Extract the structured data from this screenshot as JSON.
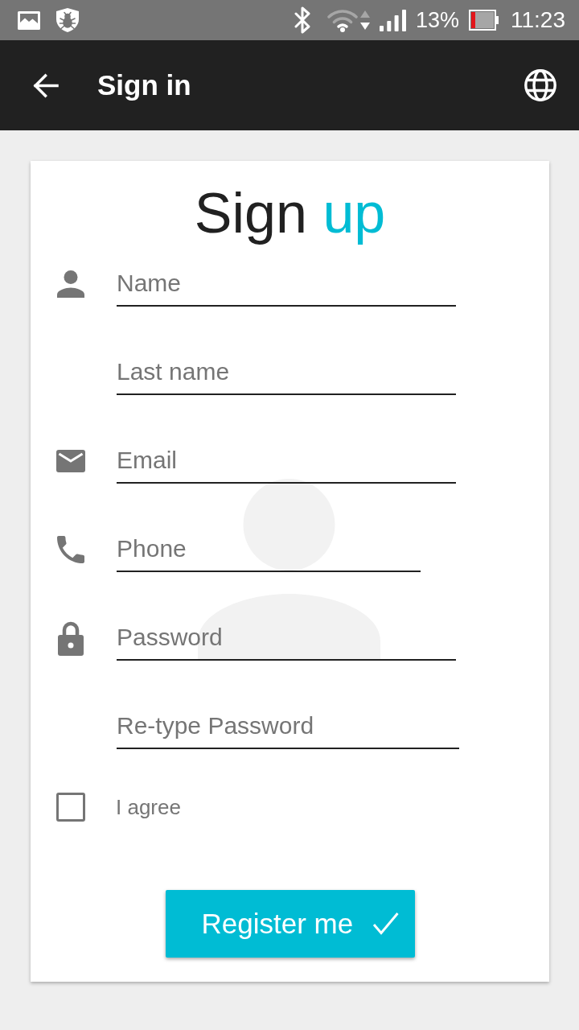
{
  "status_bar": {
    "battery_text": "13%",
    "time": "11:23"
  },
  "app_bar": {
    "title": "Sign in"
  },
  "form": {
    "title_words": [
      {
        "text": "Sign",
        "color": "#212121"
      },
      {
        "text": "up",
        "color": "#00bcd4"
      }
    ],
    "fields": [
      {
        "kind": "name",
        "placeholder": "Name"
      },
      {
        "kind": "surname",
        "placeholder": "Last name"
      },
      {
        "kind": "email",
        "placeholder": "Email"
      },
      {
        "kind": "phone",
        "placeholder": "Phone"
      },
      {
        "kind": "password",
        "placeholder": "Password"
      },
      {
        "kind": "confirm",
        "placeholder": "Re-type Password"
      }
    ],
    "agree": {
      "label": "I agree",
      "checked": false
    },
    "submit": {
      "label": "Register me"
    }
  }
}
